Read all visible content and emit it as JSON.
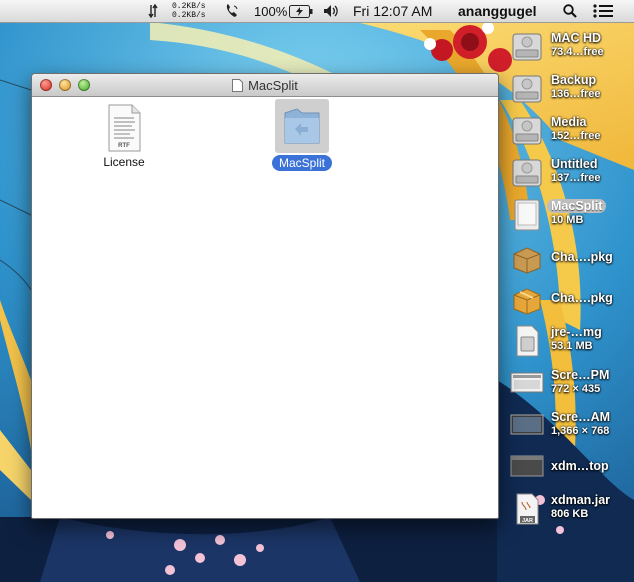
{
  "menubar": {
    "net_up": "0.2KB/s",
    "net_down": "0.2KB/s",
    "battery_percent": "100%",
    "clock": "Fri 12:07 AM",
    "user": "ananggugel"
  },
  "window": {
    "title": "MacSplit",
    "items": [
      {
        "label": "License",
        "badge": "RTF",
        "selected": false
      },
      {
        "label": "MacSplit",
        "selected": true
      }
    ]
  },
  "desktop": [
    {
      "label": "MAC HD",
      "sub": "73.4…free",
      "icon": "hard-drive-icon"
    },
    {
      "label": "Backup",
      "sub": "136…free",
      "icon": "hard-drive-icon"
    },
    {
      "label": "Media",
      "sub": "152…free",
      "icon": "hard-drive-icon"
    },
    {
      "label": "Untitled",
      "sub": "137…free",
      "icon": "hard-drive-icon"
    },
    {
      "label": "MacSplit",
      "sub": "10 MB",
      "icon": "disk-image-icon"
    },
    {
      "label": "Cha….pkg",
      "sub": "",
      "icon": "package-icon"
    },
    {
      "label": "Cha….pkg",
      "sub": "",
      "icon": "package-icon"
    },
    {
      "label": "jre-…mg",
      "sub": "53.1 MB",
      "icon": "dmg-file-icon"
    },
    {
      "label": "Scre…PM",
      "sub": "772 × 435",
      "icon": "screenshot-icon"
    },
    {
      "label": "Scre…AM",
      "sub": "1,366 × 768",
      "icon": "screenshot-icon"
    },
    {
      "label": "xdm…top",
      "sub": "",
      "icon": "app-window-icon"
    },
    {
      "label": "xdman.jar",
      "sub": "806 KB",
      "icon": "jar-file-icon"
    }
  ]
}
